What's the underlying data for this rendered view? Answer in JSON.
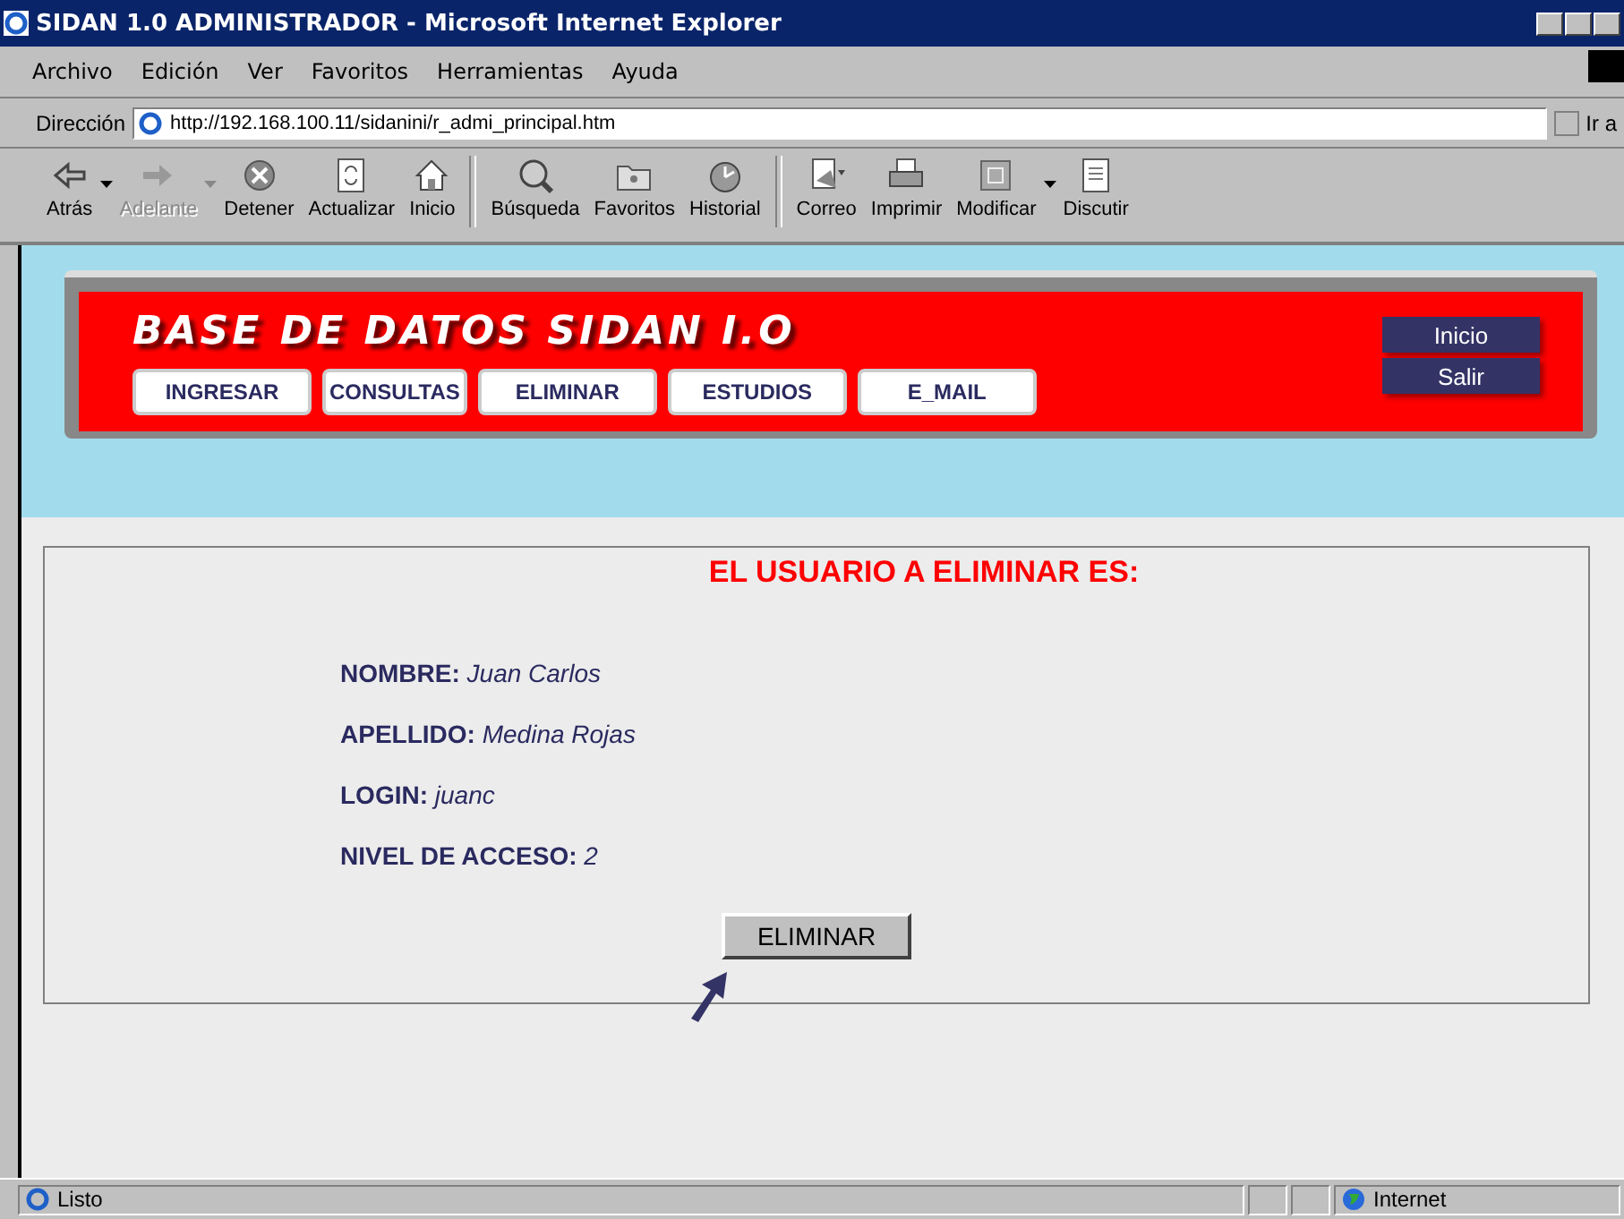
{
  "window": {
    "title": "SIDAN 1.0 ADMINISTRADOR - Microsoft Internet Explorer"
  },
  "menu": [
    "Archivo",
    "Edición",
    "Ver",
    "Favoritos",
    "Herramientas",
    "Ayuda"
  ],
  "address": {
    "label": "Dirección",
    "value": "http://192.168.100.11/sidanini/r_admi_principal.htm",
    "go": "Ir a"
  },
  "toolbar": [
    {
      "kind": "back",
      "label": "Atrás",
      "disabled": false,
      "dropdown": true
    },
    {
      "kind": "forward",
      "label": "Adelante",
      "disabled": true,
      "dropdown": true
    },
    {
      "kind": "stop",
      "label": "Detener",
      "disabled": false,
      "dropdown": false
    },
    {
      "kind": "refresh",
      "label": "Actualizar",
      "disabled": false,
      "dropdown": false
    },
    {
      "kind": "home",
      "label": "Inicio",
      "disabled": false,
      "dropdown": false
    },
    {
      "kind": "search",
      "label": "Búsqueda",
      "disabled": false,
      "dropdown": false
    },
    {
      "kind": "favorites",
      "label": "Favoritos",
      "disabled": false,
      "dropdown": false
    },
    {
      "kind": "history",
      "label": "Historial",
      "disabled": false,
      "dropdown": false
    },
    {
      "kind": "mail",
      "label": "Correo",
      "disabled": false,
      "dropdown": false
    },
    {
      "kind": "print",
      "label": "Imprimir",
      "disabled": false,
      "dropdown": false
    },
    {
      "kind": "edit",
      "label": "Modificar",
      "disabled": false,
      "dropdown": true
    },
    {
      "kind": "discuss",
      "label": "Discutir",
      "disabled": false,
      "dropdown": false
    }
  ],
  "banner": {
    "title": "BASE DE DATOS SIDAN I.O",
    "nav": [
      "INGRESAR",
      "CONSULTAS",
      "ELIMINAR",
      "ESTUDIOS",
      "E_MAIL"
    ],
    "side_buttons": [
      "Inicio",
      "Salir"
    ]
  },
  "panel": {
    "heading": "EL USUARIO A ELIMINAR ES:",
    "fields": [
      {
        "label": "NOMBRE:",
        "value": "Juan Carlos"
      },
      {
        "label": "APELLIDO:",
        "value": "Medina Rojas"
      },
      {
        "label": "LOGIN:",
        "value": "juanc"
      },
      {
        "label": "NIVEL DE ACCESO:",
        "value": "2"
      }
    ],
    "button": "ELIMINAR"
  },
  "status_bar": {
    "text": "Listo",
    "zone": "Internet"
  }
}
